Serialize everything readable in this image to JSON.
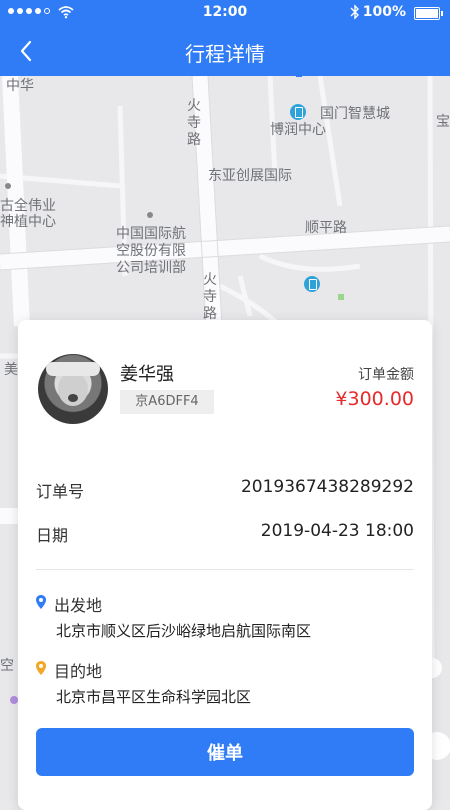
{
  "status_bar": {
    "time": "12:00",
    "battery": "100%"
  },
  "nav": {
    "title": "行程详情"
  },
  "map": {
    "labels": {
      "zhonghua": "中华",
      "huosilu_top": "火寺路",
      "guomen": "国门智慧城",
      "borun": "博润中心",
      "dongya": "东亚创展国际",
      "quanweiye": "古全伟业",
      "zhongxin": "神植中心",
      "zhongguo_hangkong": "中国国际航空股份有限公司培训部",
      "shunpinglu": "顺平路",
      "huosilu_bottom": "火寺路",
      "mei": "美",
      "bao": "宝",
      "kong": "空"
    }
  },
  "driver": {
    "name": "姜华强",
    "plate": "京A6DFF4"
  },
  "order": {
    "amount_label": "订单金额",
    "amount": "¥300.00",
    "number_label": "订单号",
    "number": "2019367438289292",
    "date_label": "日期",
    "date": "2019-04-23 18:00"
  },
  "trip": {
    "origin_label": "出发地",
    "origin": "北京市顺义区后沙峪绿地启航国际南区",
    "destination_label": "目的地",
    "destination": "北京市昌平区生命科学园北区"
  },
  "action": {
    "label": "催单"
  },
  "colors": {
    "primary": "#2f7cf6",
    "amount": "#e52b2b",
    "origin_pin": "#2f7cf6",
    "destination_pin": "#f5a623"
  }
}
